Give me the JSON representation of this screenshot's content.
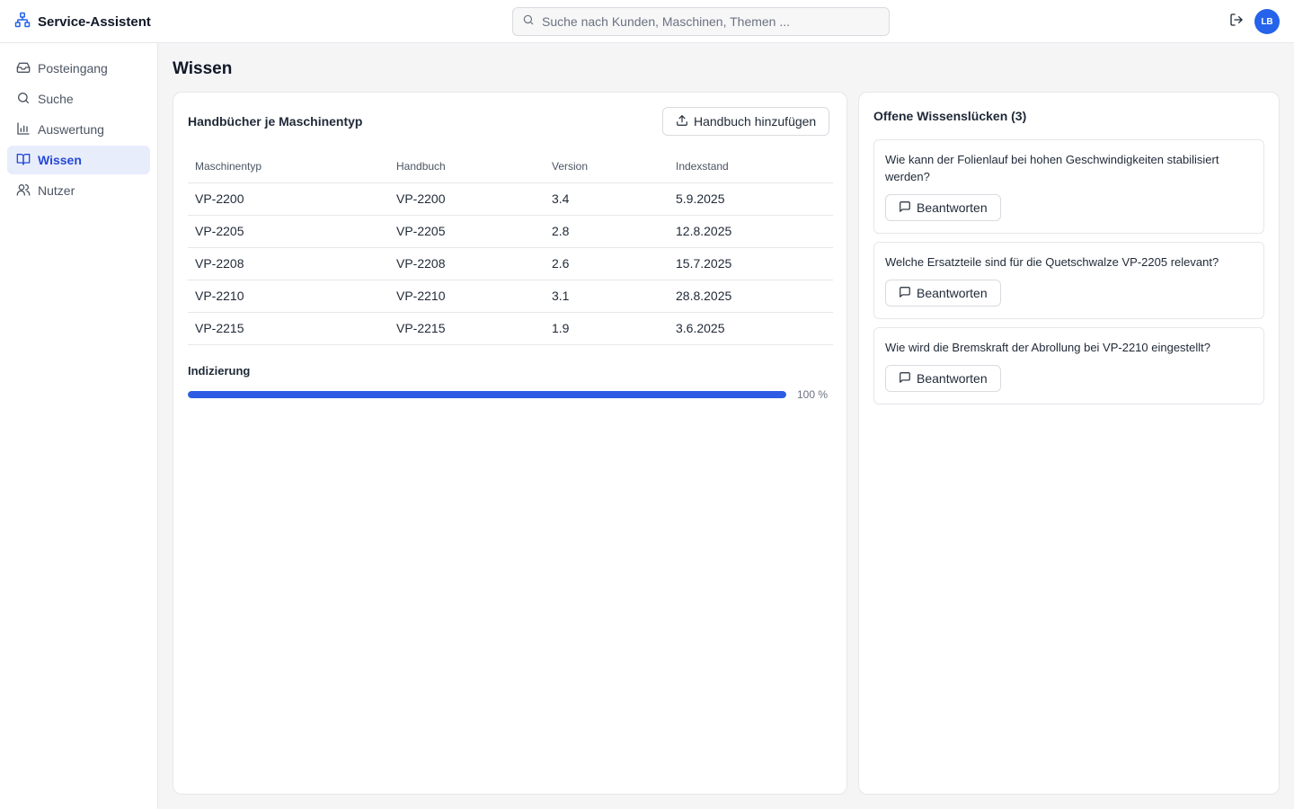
{
  "app": {
    "title": "Service-Assistent",
    "logo_icon": "network-icon"
  },
  "search": {
    "placeholder": "Suche nach Kunden, Maschinen, Themen ..."
  },
  "user": {
    "initials": "LB"
  },
  "sidebar": {
    "items": [
      {
        "label": "Posteingang",
        "icon": "inbox-icon",
        "active": false
      },
      {
        "label": "Suche",
        "icon": "search-icon",
        "active": false
      },
      {
        "label": "Auswertung",
        "icon": "bar-chart-icon",
        "active": false
      },
      {
        "label": "Wissen",
        "icon": "book-icon",
        "active": true
      },
      {
        "label": "Nutzer",
        "icon": "users-icon",
        "active": false
      }
    ]
  },
  "page": {
    "title": "Wissen"
  },
  "manuals": {
    "title": "Handbücher je Maschinentyp",
    "add_label": "Handbuch hinzufügen",
    "columns": [
      "Maschinentyp",
      "Handbuch",
      "Version",
      "Indexstand"
    ],
    "rows": [
      [
        "VP-2200",
        "VP-2200",
        "3.4",
        "5.9.2025"
      ],
      [
        "VP-2205",
        "VP-2205",
        "2.8",
        "12.8.2025"
      ],
      [
        "VP-2208",
        "VP-2208",
        "2.6",
        "15.7.2025"
      ],
      [
        "VP-2210",
        "VP-2210",
        "3.1",
        "28.8.2025"
      ],
      [
        "VP-2215",
        "VP-2215",
        "1.9",
        "3.6.2025"
      ]
    ]
  },
  "indexing": {
    "label": "Indizierung",
    "percent": 100,
    "percent_text": "100 %"
  },
  "gaps": {
    "title": "Offene Wissenslücken (3)",
    "answer_label": "Beantworten",
    "items": [
      {
        "question": "Wie kann der Folienlauf bei hohen Geschwindigkeiten stabilisiert werden?"
      },
      {
        "question": "Welche Ersatzteile sind für die Quetschwalze VP-2205 relevant?"
      },
      {
        "question": "Wie wird die Bremskraft der Abrollung bei VP-2210 eingestellt?"
      }
    ]
  },
  "colors": {
    "accent": "#2563eb",
    "active_bg": "#e8edfb",
    "progress": "#2d5be3"
  }
}
